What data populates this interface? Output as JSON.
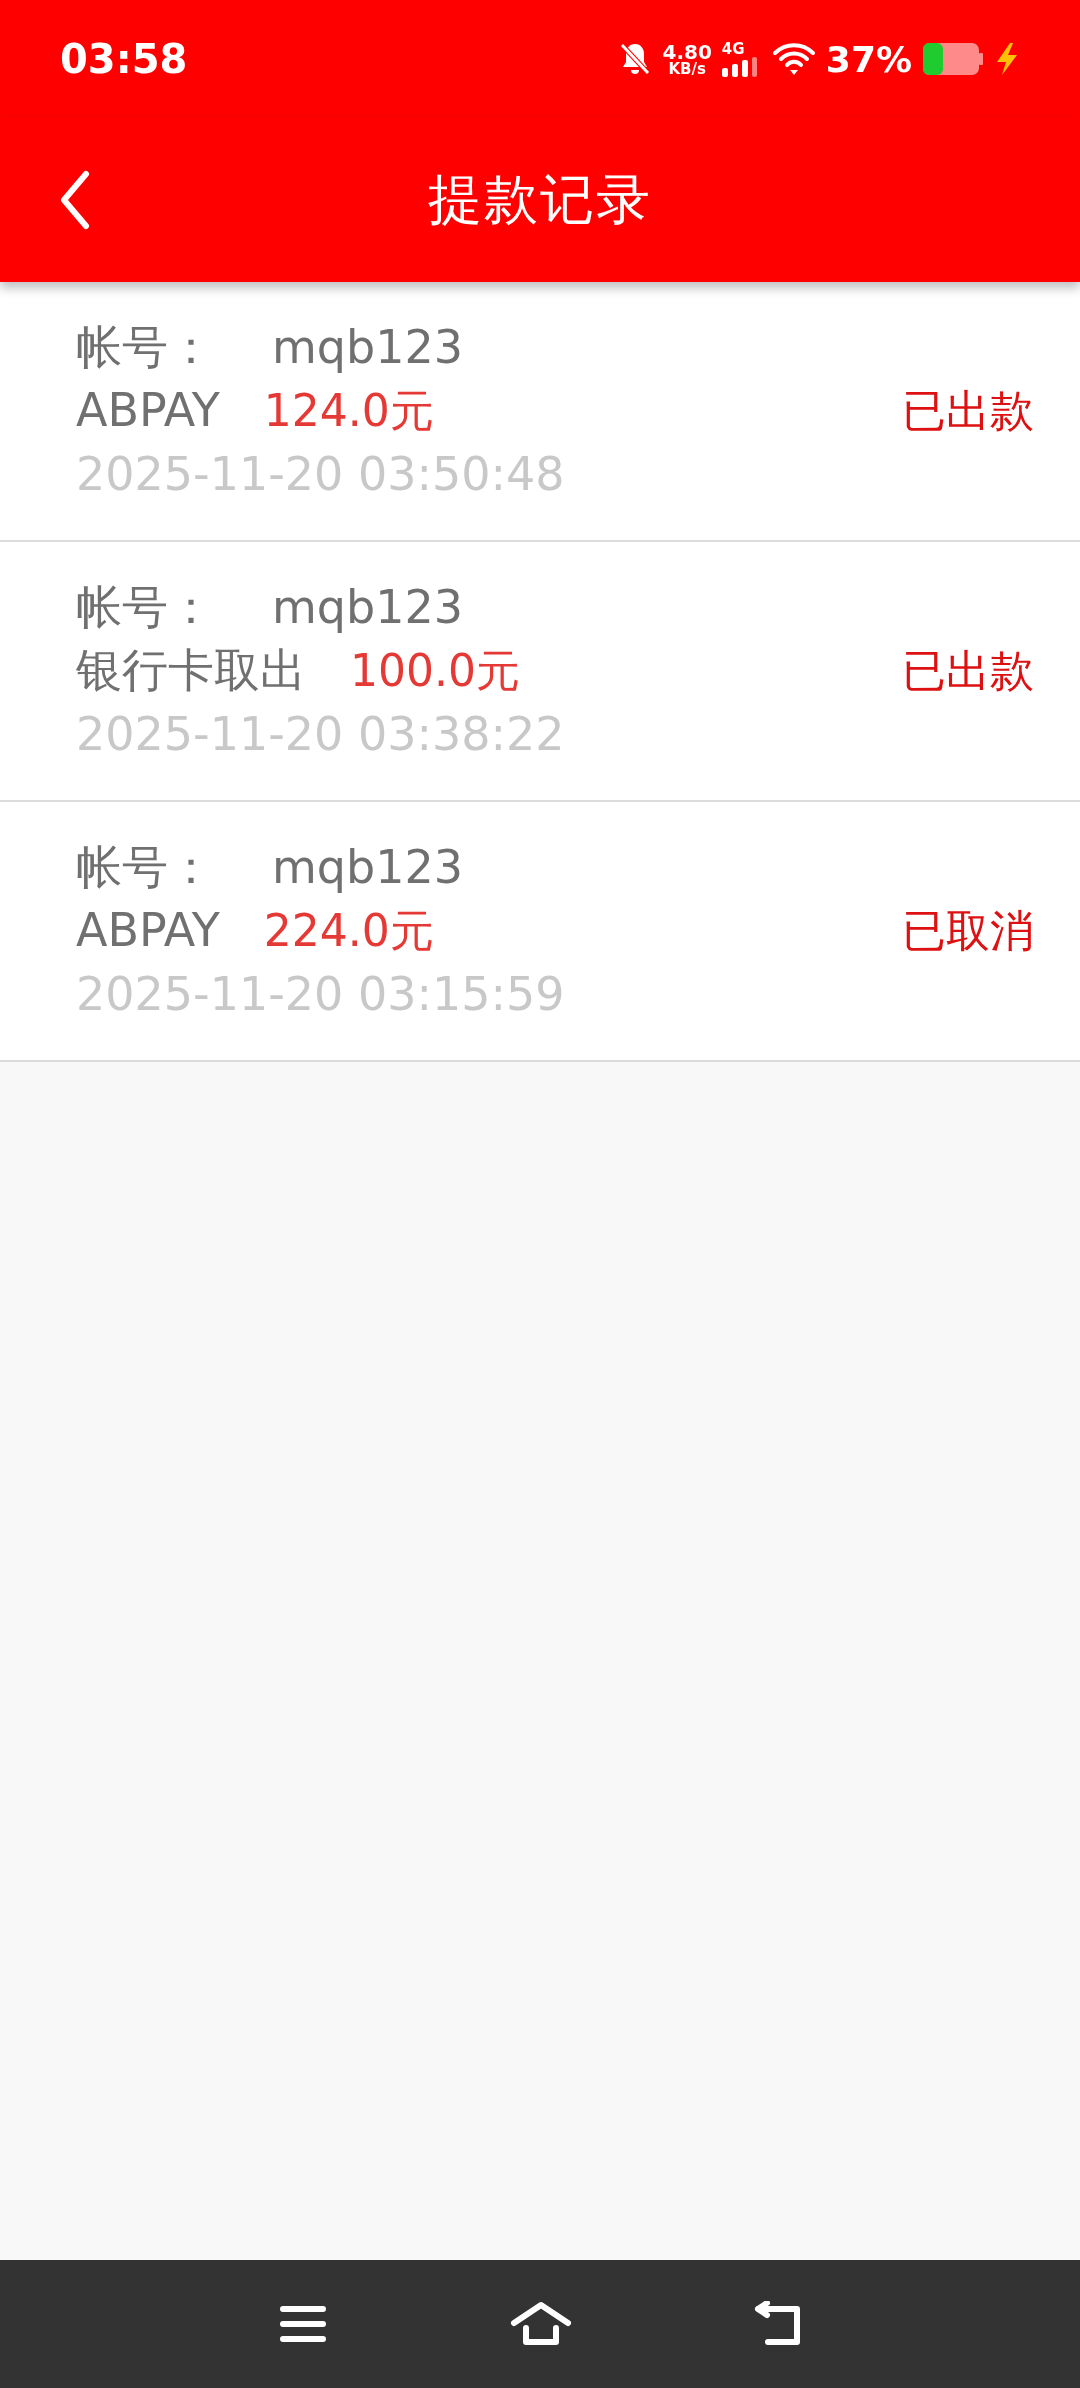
{
  "status_bar": {
    "time": "03:58",
    "net_speed_value": "4.80",
    "net_speed_unit": "KB/s",
    "network_type": "4G",
    "battery_percent": "37%"
  },
  "header": {
    "title": "提款记录"
  },
  "records": [
    {
      "account_label": "帐号：",
      "account": "mqb123",
      "method": "ABPAY",
      "amount": "124.0元",
      "time": "2025-11-20 03:50:48",
      "status": "已出款"
    },
    {
      "account_label": "帐号：",
      "account": "mqb123",
      "method": "银行卡取出",
      "amount": "100.0元",
      "time": "2025-11-20 03:38:22",
      "status": "已出款"
    },
    {
      "account_label": "帐号：",
      "account": "mqb123",
      "method": "ABPAY",
      "amount": "224.0元",
      "time": "2025-11-20 03:15:59",
      "status": "已取消"
    }
  ]
}
